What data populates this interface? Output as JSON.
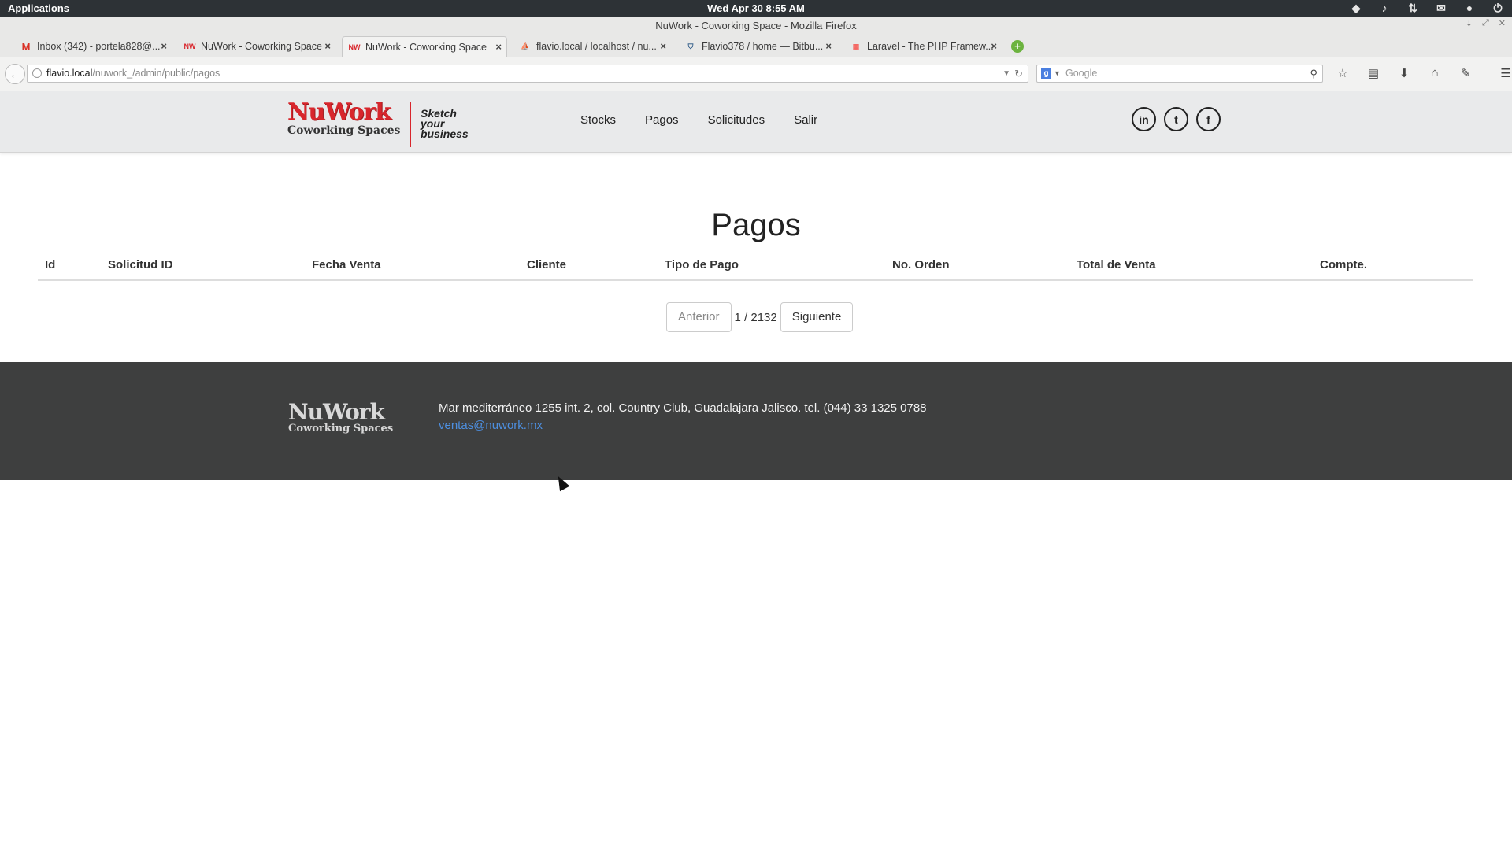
{
  "os_panel": {
    "applications": "Applications",
    "clock": "Wed Apr 30  8:55 AM",
    "tray_icons": [
      "dropbox-icon",
      "volume-icon",
      "network-icon",
      "mail-icon",
      "user-icon",
      "power-icon"
    ]
  },
  "window": {
    "title": "NuWork - Coworking Space - Mozilla Firefox"
  },
  "tabs": [
    {
      "label": "Inbox (342) - portela828@...",
      "icon": "gmail-icon"
    },
    {
      "label": "NuWork - Coworking Space",
      "icon": "nuwork-favicon"
    },
    {
      "label": "NuWork - Coworking Space",
      "icon": "nuwork-favicon"
    },
    {
      "label": "flavio.local / localhost / nu...",
      "icon": "phpmyadmin-favicon"
    },
    {
      "label": "Flavio378 / home — Bitbu...",
      "icon": "bitbucket-favicon"
    },
    {
      "label": "Laravel - The PHP Framew...",
      "icon": "laravel-favicon"
    }
  ],
  "url": {
    "host": "flavio.local",
    "path": "/nuwork_/admin/public/pagos"
  },
  "search": {
    "placeholder": "Google"
  },
  "site": {
    "brand": "NuWork",
    "brand_sub": "Coworking Spaces",
    "tagline_1": "Sketch",
    "tagline_2": "your",
    "tagline_3": "business",
    "nav": [
      "Stocks",
      "Pagos",
      "Solicitudes",
      "Salir"
    ],
    "social": [
      "in",
      "t",
      "f"
    ]
  },
  "main": {
    "title": "Pagos",
    "columns": [
      "Id",
      "Solicitud ID",
      "Fecha Venta",
      "Cliente",
      "Tipo de Pago",
      "No. Orden",
      "Total de Venta",
      "Compte."
    ],
    "pager": {
      "prev": "Anterior",
      "count": "1 / 2132",
      "next": "Siguiente"
    }
  },
  "footer": {
    "brand": "NuWork",
    "brand_sub": "Coworking Spaces",
    "address": "Mar mediterráneo 1255 int. 2, col. Country Club, Guadalajara Jalisco. tel. (044) 33 1325 0788",
    "email": "ventas@nuwork.mx"
  },
  "colors": {
    "brand_red": "#d8262c",
    "footer_bg": "#3e3f3f",
    "link_blue": "#4d8fe0"
  }
}
